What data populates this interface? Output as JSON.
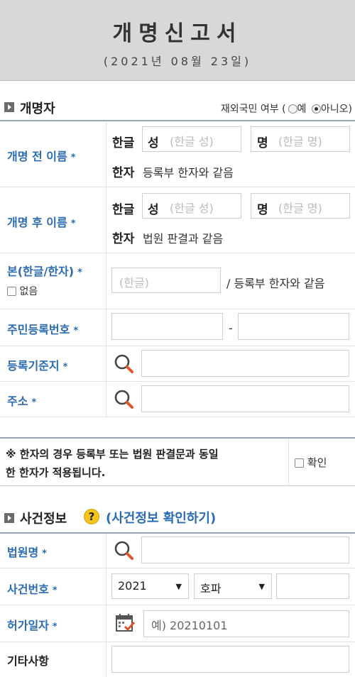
{
  "form": {
    "title": "개명신고서",
    "date": "(2021년 08월 23일)"
  },
  "applicant_section": {
    "title": "개명자",
    "overseas_label": "재외국민 여부 (",
    "overseas_yes": "예",
    "overseas_no": "아니오",
    "overseas_close": ")",
    "overseas_selected": "아니오"
  },
  "name_before": {
    "label": "개명 전 이름",
    "hangul_label": "한글",
    "surname_label": "성",
    "surname_placeholder": "(한글 성)",
    "given_label": "명",
    "given_placeholder": "(한글 명)",
    "hanja_label": "한자",
    "hanja_text": "등록부 한자와 같음"
  },
  "name_after": {
    "label": "개명 후 이름",
    "hangul_label": "한글",
    "surname_label": "성",
    "surname_placeholder": "(한글 성)",
    "given_label": "명",
    "given_placeholder": "(한글 명)",
    "hanja_label": "한자",
    "hanja_text": "법원 판결과 같음"
  },
  "origin": {
    "label": "본(한글/한자)",
    "none_label": "없음",
    "placeholder": "(한글)",
    "suffix": "/ 등록부 한자와 같음"
  },
  "rrn": {
    "label": "주민등록번호",
    "separator": "-"
  },
  "registry_base": {
    "label": "등록기준지"
  },
  "address": {
    "label": "주소"
  },
  "notice": {
    "line1": "※ 한자의 경우 등록부 또는 법원 판결문과 동일",
    "line2": "한 한자가 적용됩니다.",
    "confirm_label": "확인"
  },
  "case_section": {
    "title": "사건정보",
    "help_symbol": "?",
    "link": "(사건정보 확인하기)"
  },
  "court": {
    "label": "법원명"
  },
  "case_number": {
    "label": "사건번호",
    "year": "2021",
    "type": "호파"
  },
  "permit_date": {
    "label": "허가일자",
    "placeholder": "예) 20210101"
  },
  "other": {
    "label": "기타사항"
  },
  "star": "*"
}
